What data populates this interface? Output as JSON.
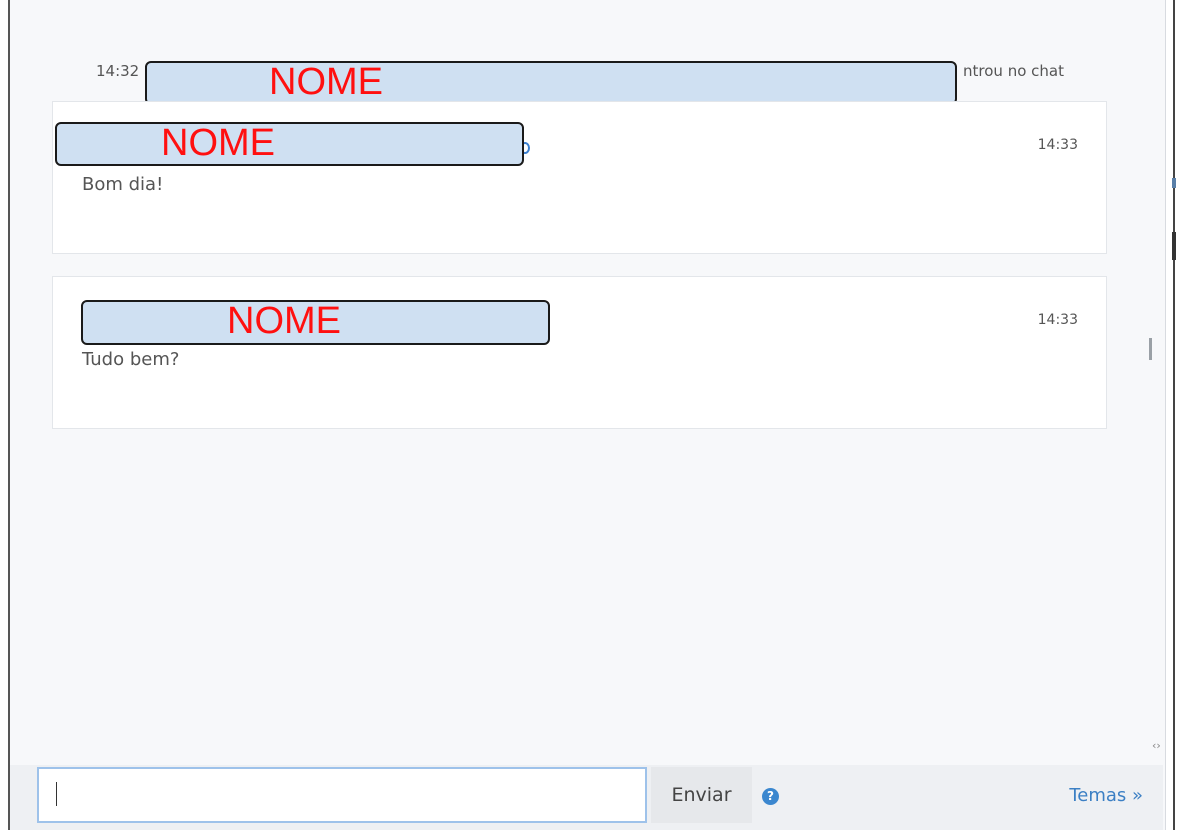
{
  "notice": {
    "time": "14:32",
    "name_redacted": "NOME",
    "text": "ntrou no chat"
  },
  "messages": [
    {
      "author_redacted": "NOME",
      "time": "14:33",
      "body": "Bom dia!"
    },
    {
      "author_redacted": "NOME",
      "time": "14:33",
      "body": "Tudo bem?"
    }
  ],
  "composer": {
    "input_value": "",
    "send_label": "Enviar",
    "help_icon": "question-circle-icon",
    "help_glyph": "?",
    "themes_label": "Temas »"
  },
  "colors": {
    "accent": "#3b7fc4",
    "redaction_fill": "#cfe0f2",
    "redaction_text": "#ff1010"
  }
}
